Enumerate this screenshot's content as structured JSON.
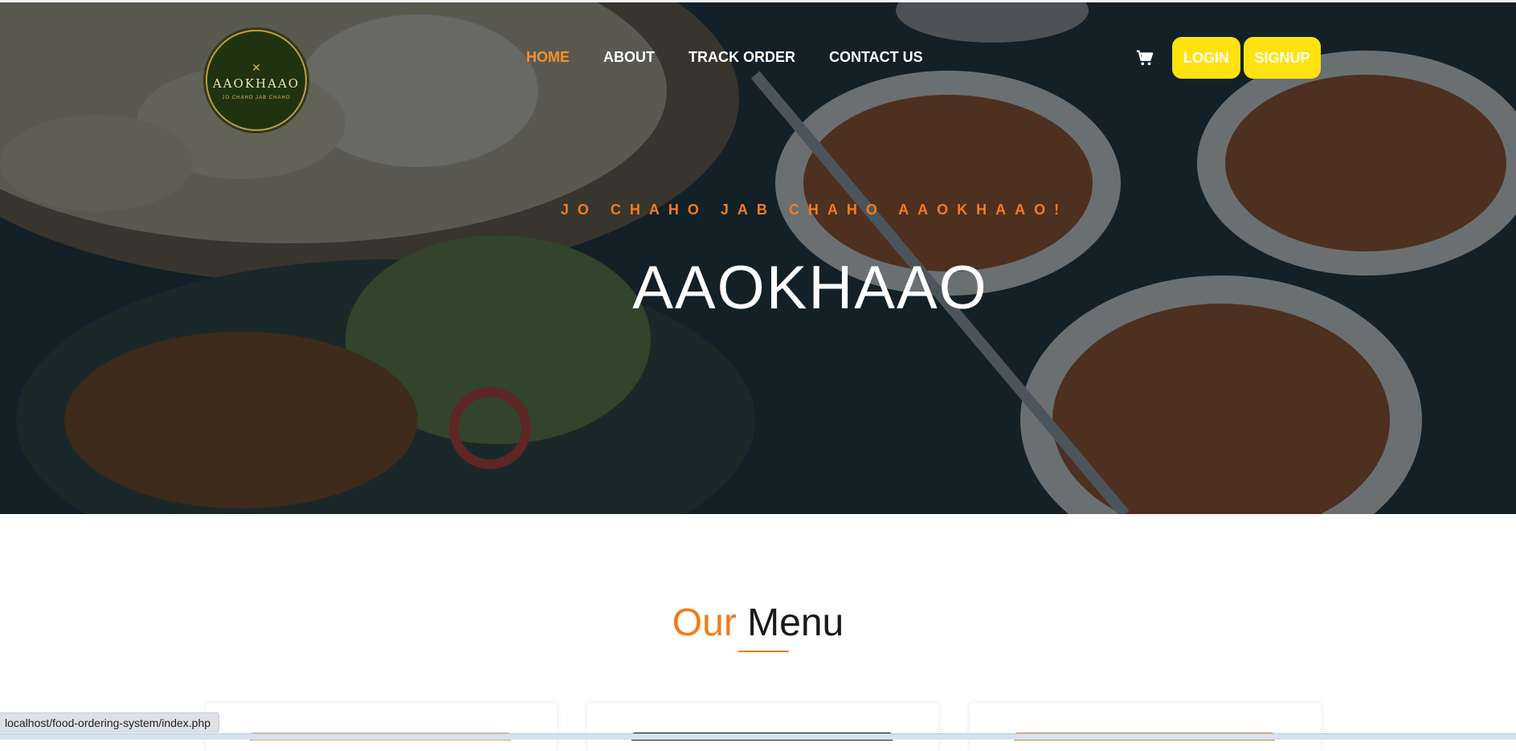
{
  "header": {
    "logo": {
      "text": "AAOKHAAO",
      "sub": "JO CHAHO JAB CHAHO"
    },
    "nav": [
      {
        "label": "HOME",
        "active": true
      },
      {
        "label": "ABOUT",
        "active": false
      },
      {
        "label": "TRACK ORDER",
        "active": false
      },
      {
        "label": "CONTACT US",
        "active": false
      }
    ],
    "cart_icon": "cart-icon",
    "login_label": "LOGIN",
    "signup_label": "SIGNUP"
  },
  "hero": {
    "tagline": "JO CHAHO JAB CHAHO AAOKHAAO!",
    "title": "AAOKHAAO"
  },
  "menu_section": {
    "title_accent": "Our",
    "title_rest": "Menu"
  },
  "status_bar": {
    "url": "localhost/food-ordering-system/index.php"
  },
  "colors": {
    "accent": "#f7902e",
    "button": "#ffe20f",
    "hero_overlay": "#0c1820"
  }
}
